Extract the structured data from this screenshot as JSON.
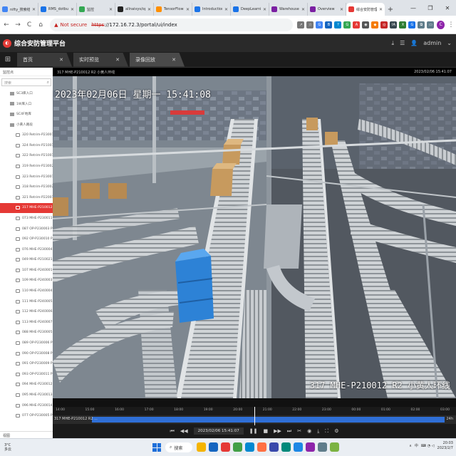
{
  "browser": {
    "tabs": [
      {
        "title": "nifty_搜索结果",
        "color": "#4285f4"
      },
      {
        "title": "RMS_dotbuild",
        "color": "#1a73e8"
      },
      {
        "title": "监控",
        "color": "#34a853"
      },
      {
        "title": "allnaivys/ope",
        "color": "#222222"
      },
      {
        "title": "TensorFlow",
        "color": "#ff8f00"
      },
      {
        "title": "Introduction",
        "color": "#1a73e8"
      },
      {
        "title": "DeepLearnin",
        "color": "#1a73e8"
      },
      {
        "title": "Warehouse",
        "color": "#7b1fa2"
      },
      {
        "title": "Overview",
        "color": "#7b1fa2"
      },
      {
        "title": "综合安防管理",
        "color": "#e53935",
        "active": true
      }
    ],
    "new_tab": "+",
    "window_controls": {
      "minimize": "—",
      "restore": "❐",
      "close": "✕"
    },
    "nav": {
      "back": "←",
      "forward": "→",
      "reload": "C",
      "home": "⌂"
    },
    "address": {
      "warning": "▲",
      "not_secure": "Not secure",
      "protocol": "https",
      "rest": "://172.16.72.3/portal/ui/index"
    },
    "extensions": [
      {
        "label": "↗",
        "color": "#777777"
      },
      {
        "label": "☆",
        "color": "#777777"
      },
      {
        "label": "G",
        "color": "#4285f4"
      },
      {
        "label": "B",
        "color": "#1565c0"
      },
      {
        "label": "?",
        "color": "#0288d1"
      },
      {
        "label": "G",
        "color": "#34a853"
      },
      {
        "label": "A",
        "color": "#e53935"
      },
      {
        "label": "◉",
        "color": "#555555"
      },
      {
        "label": "◆",
        "color": "#f57c00"
      },
      {
        "label": "◎",
        "color": "#c62828"
      },
      {
        "label": "IA",
        "color": "#37474f"
      },
      {
        "label": "X",
        "color": "#2e7d32"
      },
      {
        "label": "G",
        "color": "#1a73e8"
      },
      {
        "label": "⧉",
        "color": "#607d8b"
      },
      {
        "label": "▭",
        "color": "#607d8b"
      }
    ],
    "profile_initial": "C",
    "menu": "⋮"
  },
  "app": {
    "logo": "◐",
    "title": "综合安防管理平台",
    "download_icon": "⤓",
    "menu_icon": "☰",
    "user_icon": "👤",
    "user": "admin",
    "dropdown": "⌄"
  },
  "navtabs": {
    "grid_icon": "⊞",
    "items": [
      {
        "label": "首页",
        "close": "✕"
      },
      {
        "label": "实时预览",
        "close": "✕"
      },
      {
        "label": "录像回放",
        "close": "✕",
        "active": true
      }
    ]
  },
  "sidebar": {
    "header": "监控点",
    "search_placeholder": "搜索",
    "search_icon": "⌕",
    "groups": [
      {
        "label": "SC3库入口"
      },
      {
        "label": "1W库入口"
      },
      {
        "label": "SC4F地库"
      },
      {
        "label": "小黄人路段"
      }
    ],
    "cameras": [
      {
        "label": "320 Retrim-P230014"
      },
      {
        "label": "324 Retrim-P210018"
      },
      {
        "label": "322 Retrim-P210016"
      },
      {
        "label": "319 Retrim-P230026"
      },
      {
        "label": "323 Retrim-P230017"
      },
      {
        "label": "318 Retrim-P230025"
      },
      {
        "label": "321 Retrim-P220015"
      },
      {
        "label": "317 MHE-P210012 R2",
        "active": true
      },
      {
        "label": "073 MHE-P230011 P"
      },
      {
        "label": "087 OP-P230003 P3"
      },
      {
        "label": "092 OP-P230010 P3"
      },
      {
        "label": "076 MHE-P230004 P"
      },
      {
        "label": "049 MHE-P210021 P"
      },
      {
        "label": "107 MHE-P240001 P"
      },
      {
        "label": "109 MHE-P240003 P"
      },
      {
        "label": "110 MHE-P240004 P"
      },
      {
        "label": "111 MHE-P240005 P"
      },
      {
        "label": "112 MHE-P240006 P"
      },
      {
        "label": "113 MHE-P240007 P"
      },
      {
        "label": "088 MHE-P230005"
      },
      {
        "label": "089 OP-P230006 P3"
      },
      {
        "label": "090 OP-P230008 P3"
      },
      {
        "label": "091 OP-P230009 P3"
      },
      {
        "label": "093 OP-P230011 P3"
      },
      {
        "label": "094 MHE-P230012 P"
      },
      {
        "label": "095 MHE-P230013 P"
      },
      {
        "label": "096 MHE-P230014 P"
      },
      {
        "label": "077 OP-P230005 P3"
      }
    ],
    "footer": "视图"
  },
  "video": {
    "bar_left": "317 MHE-P210012 R2 小黄人环线",
    "bar_right": "2023/02/06 15:41:07",
    "osd_top": "2023年02月06日 星期一 15:41:08",
    "osd_bottom": "317 MHE-P210012 R2 小黄人环线"
  },
  "timeline": {
    "ticks": [
      "14:00",
      "15:00",
      "16:00",
      "17:00",
      "18:00",
      "19:00",
      "20:00",
      "21:00",
      "22:00",
      "23:00",
      "00:00",
      "01:00",
      "02:00",
      "03:00"
    ],
    "track_label": "317 MHE-P210012 R2 ...",
    "track_end": "24h",
    "time": "2023/02/06 15:41:07",
    "buttons": {
      "prev": "⏮",
      "rewind": "◀◀",
      "pause": "❚❚",
      "stop": "■",
      "forward": "▶▶",
      "next": "⏭",
      "cut": "✂",
      "snapshot": "◉",
      "download": "⤓",
      "fullscreen": "⛶"
    },
    "settings_icon": "⚙"
  },
  "taskbar": {
    "weather_temp": "3°C",
    "weather_text": "多云",
    "search_icon": "⌕",
    "search": "搜索",
    "app_colors": [
      "#f4b400",
      "#1565c0",
      "#e53935",
      "#43a047",
      "#0288d1",
      "#ff7043",
      "#3949ab",
      "#00897b",
      "#1e88e5",
      "#8e24aa",
      "#607d8b",
      "#7cb342"
    ],
    "tray_up": "∧",
    "ime": "中",
    "tray_icons": "⌨ ◔ ◁",
    "time": "20:03",
    "date": "2023/2/7"
  }
}
